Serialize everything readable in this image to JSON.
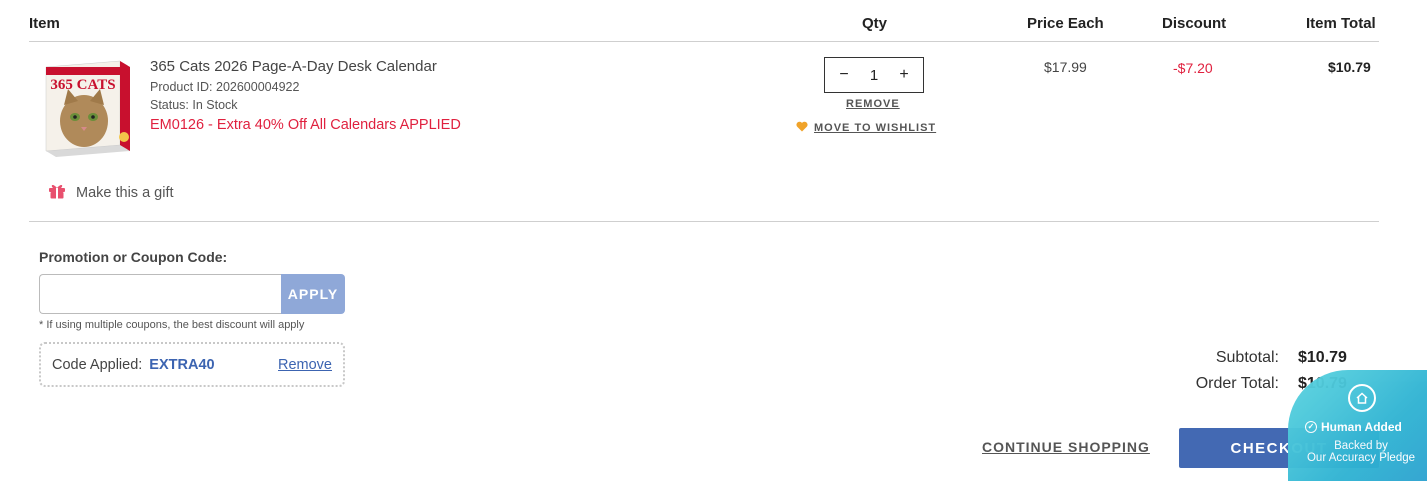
{
  "table": {
    "headers": {
      "item": "Item",
      "qty": "Qty",
      "price_each": "Price Each",
      "discount": "Discount",
      "item_total": "Item Total"
    }
  },
  "cart_item": {
    "name": "365 Cats 2026 Page-A-Day Desk Calendar",
    "product_id": "Product ID: 202600004922",
    "status": "Status: In Stock",
    "promo": "EM0126 - Extra 40% Off All Calendars APPLIED",
    "thumbnail_text": "365 CATS",
    "quantity": "1",
    "qty_minus": "−",
    "qty_plus": "+",
    "remove_label": "REMOVE",
    "wishlist_label": "MOVE TO WISHLIST",
    "price_each": "$17.99",
    "discount": "-$7.20",
    "item_total": "$10.79"
  },
  "gift": {
    "label": "Make this a gift",
    "icon": "gift-icon"
  },
  "coupon": {
    "label": "Promotion or Coupon Code:",
    "input_value": "",
    "apply_label": "APPLY",
    "note": "* If using multiple coupons, the best discount will apply",
    "applied_label": "Code Applied:",
    "applied_code": "EXTRA40",
    "remove_label": "Remove"
  },
  "summary": {
    "subtotal_label": "Subtotal:",
    "subtotal_value": "$10.79",
    "order_total_label": "Order Total:",
    "order_total_value": "$10.79"
  },
  "actions": {
    "continue_label": "CONTINUE SHOPPING",
    "checkout_label": "CHECKOUT"
  },
  "badge": {
    "line1": "Human Added",
    "line2": "Backed by",
    "line3": "Our Accuracy Pledge"
  },
  "colors": {
    "accent_blue": "#4369b3",
    "promo_red": "#e0213f",
    "apply_button": "#8fa8d8",
    "badge_teal": "#2fb3d3",
    "heart": "#f0a32a",
    "gift": "#e8506e"
  }
}
